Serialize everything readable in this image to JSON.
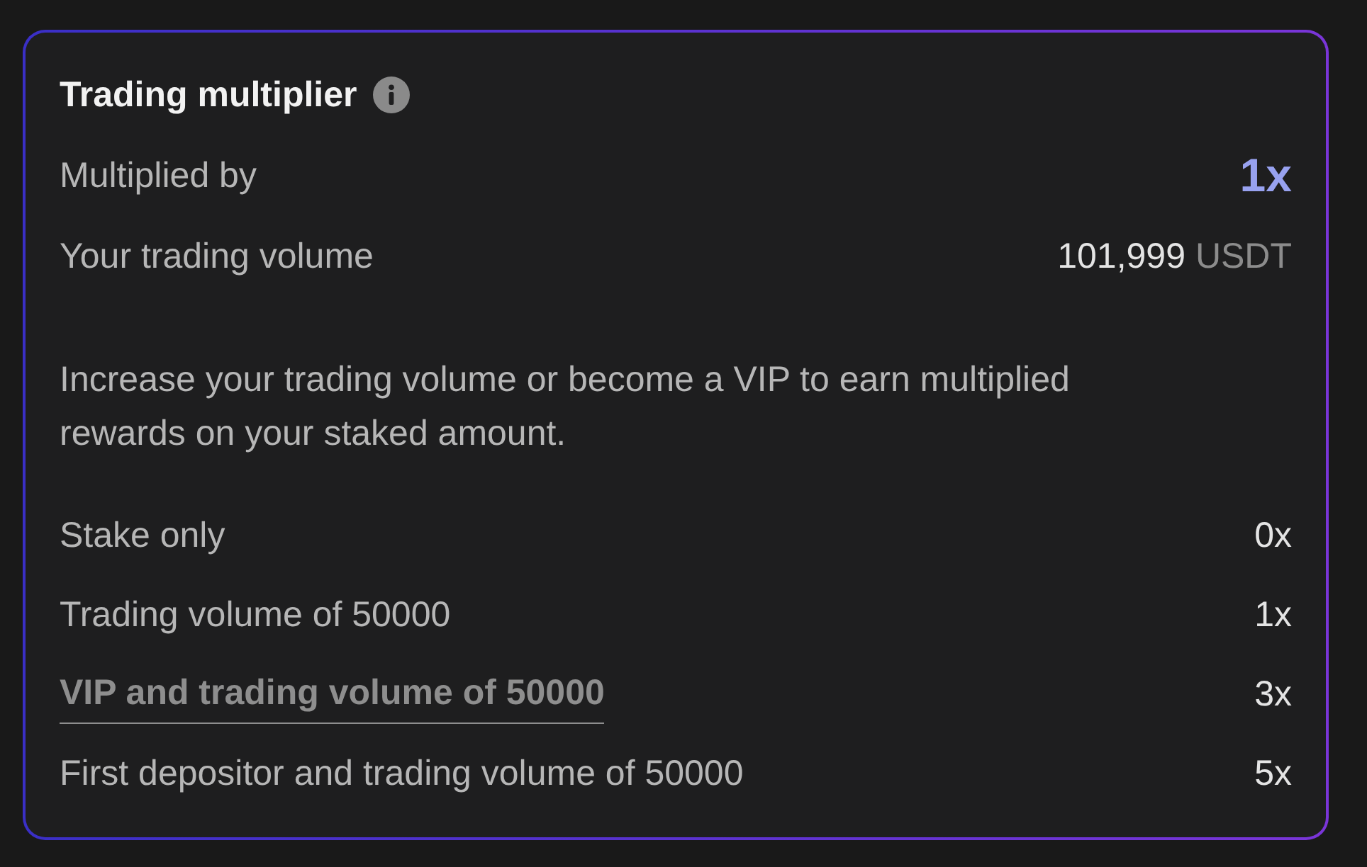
{
  "card": {
    "title": "Trading multiplier",
    "summary": [
      {
        "kind": "multiplier",
        "label": "Multiplied by",
        "value": "1x"
      },
      {
        "kind": "amount",
        "label": "Your trading volume",
        "value": "101,999",
        "unit": "USDT"
      }
    ],
    "description": "Increase your trading volume or become a VIP to earn multiplied rewards on your staked amount.",
    "tiers": [
      {
        "kind": "plain",
        "label": "Stake only",
        "multiplier": "0x"
      },
      {
        "kind": "plain",
        "label": "Trading volume of 50000",
        "multiplier": "1x"
      },
      {
        "kind": "link",
        "label": "VIP and trading volume of 50000",
        "multiplier": "3x"
      },
      {
        "kind": "plain",
        "label": "First depositor and trading volume of 50000",
        "multiplier": "5x"
      }
    ]
  }
}
